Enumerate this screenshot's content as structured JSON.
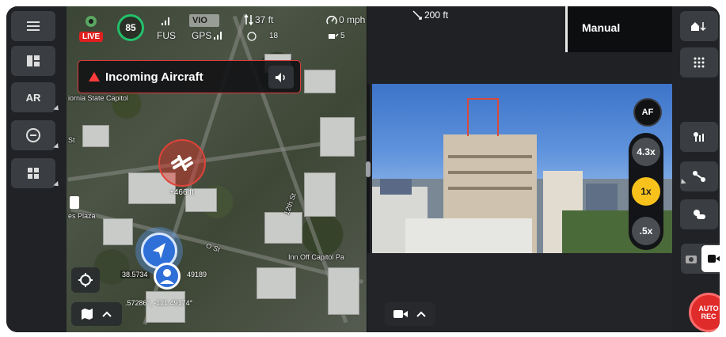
{
  "left_rail": {
    "items": [
      {
        "label": "",
        "icon": "menu-icon"
      },
      {
        "label": "",
        "icon": "layout-icon"
      },
      {
        "label": "AR",
        "icon": ""
      },
      {
        "label": "",
        "icon": "obstacle-avoidance-icon"
      },
      {
        "label": "",
        "icon": "grid-icon"
      }
    ]
  },
  "status": {
    "live_label": "LIVE",
    "battery": "85",
    "battery_color": "#23c16b",
    "fus_label": "FUS",
    "gps_label": "GPS",
    "vio_label": "VIO",
    "altitude": "37 ft",
    "speed": "0 mph",
    "count_a": "18",
    "count_b": "5",
    "distance": "200 ft"
  },
  "alert": {
    "text": "Incoming Aircraft",
    "color": "#e03c3c",
    "mute_icon": "speaker-icon"
  },
  "map": {
    "labels": {
      "capitol": "iornia State Capitol",
      "street_s": "St",
      "plaza": "es Plaza",
      "st_12": "12th St",
      "o_st": "O St",
      "inn": "Inn Off Capitol Pa",
      "street_12_side": "12th St"
    },
    "aircraft_offset": "+466 ft",
    "drone_coords": "38.5734",
    "drone_coords_2": "49189",
    "bottom_coords": ".57286°, -121.49174°"
  },
  "camera": {
    "mode_label": "Manual",
    "af_label": "AF",
    "zoom_levels": [
      "4.3x",
      "1x",
      ".5x"
    ],
    "zoom_active": "1x",
    "accent": "#f7c21b"
  },
  "right_rail": {
    "items": [
      "home-return-icon",
      "grid-dots-icon",
      "gimbal-icon",
      "waypoint-icon",
      "weather-icon"
    ],
    "photo_icon": "photo-mode-icon",
    "video_icon": "video-mode-icon",
    "autorec_line1": "AUTO",
    "autorec_line2": "REC",
    "autorec_color": "#e02b2b"
  }
}
